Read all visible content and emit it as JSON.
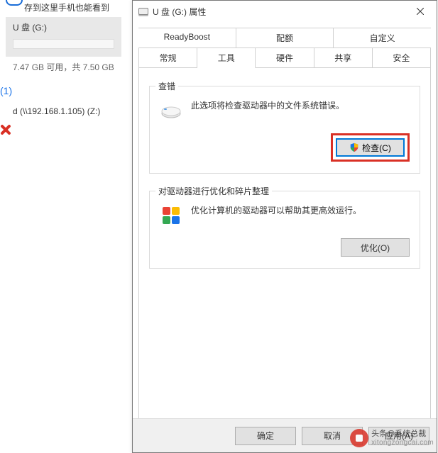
{
  "left": {
    "phone_text": "存到这里手机也能看到",
    "drive_title": "U 盘 (G:)",
    "drive_info": "7.47 GB 可用，共 7.50 GB",
    "section_num": "(1)",
    "net_drive": "d (\\\\192.168.1.105) (Z:)"
  },
  "dialog": {
    "title": "U 盘 (G:) 属性",
    "tabs_top": [
      "ReadyBoost",
      "配额",
      "自定义"
    ],
    "tabs_bottom": [
      "常规",
      "工具",
      "硬件",
      "共享",
      "安全"
    ],
    "active_tab": "工具",
    "group_check": {
      "legend": "查错",
      "desc": "此选项将检查驱动器中的文件系统错误。",
      "button": "检查(C)"
    },
    "group_opt": {
      "legend": "对驱动器进行优化和碎片整理",
      "desc": "优化计算机的驱动器可以帮助其更高效运行。",
      "button": "优化(O)"
    },
    "buttons": {
      "ok": "确定",
      "cancel": "取消",
      "apply": "应用(A)"
    }
  },
  "watermark": {
    "line1": "头条@系统总裁",
    "line2": "xitongzongcai.com"
  }
}
